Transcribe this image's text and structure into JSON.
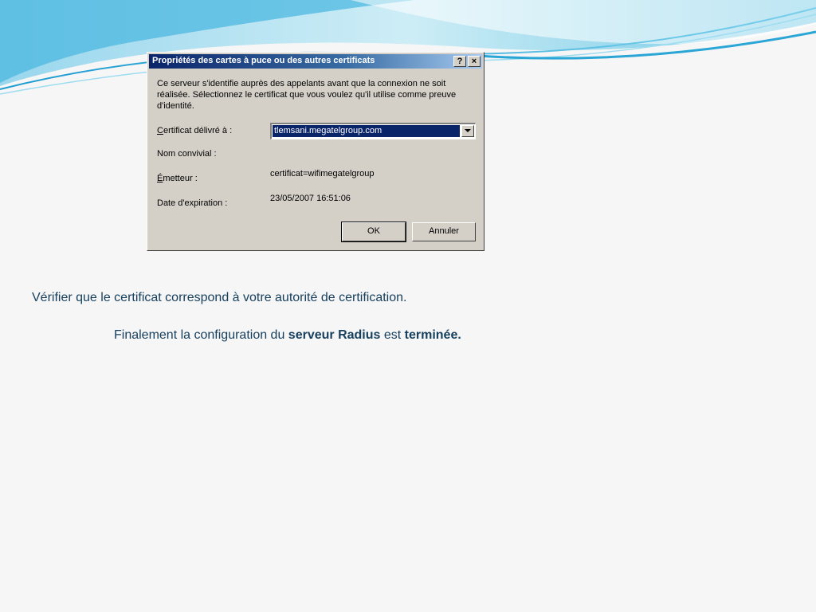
{
  "dialog": {
    "title": "Propriétés des cartes à puce ou des autres certificats",
    "help_label": "?",
    "close_label": "×",
    "intro_text": "Ce serveur s'identifie auprès des appelants avant que la connexion ne soit réalisée. Sélectionnez le certificat que vous voulez qu'il utilise comme preuve d'identité.",
    "certificate_label_first": "C",
    "certificate_label_rest": "ertificat délivré à :",
    "certificate_value": "tlemsani.megatelgroup.com",
    "friendly_name_label": "Nom convivial :",
    "friendly_name_value": "",
    "issuer_label_first": "É",
    "issuer_label_rest": "metteur :",
    "issuer_value": "certificat=wifimegatelgroup",
    "expiration_label": "Date d'expiration :",
    "expiration_value": "23/05/2007 16:51:06",
    "ok_label": "OK",
    "cancel_label": "Annuler"
  },
  "captions": {
    "line1": "Vérifier que le certificat correspond à votre autorité de certification.",
    "line2_part1": "Finalement la configuration du ",
    "line2_bold1": "serveur Radius",
    "line2_part2": " est ",
    "line2_bold2": "terminée."
  },
  "colors": {
    "caption_text": "#17405e",
    "dialog_face": "#d4d0c8",
    "titlebar": "#0a246a",
    "wave_accent": "#2aa6d6"
  }
}
